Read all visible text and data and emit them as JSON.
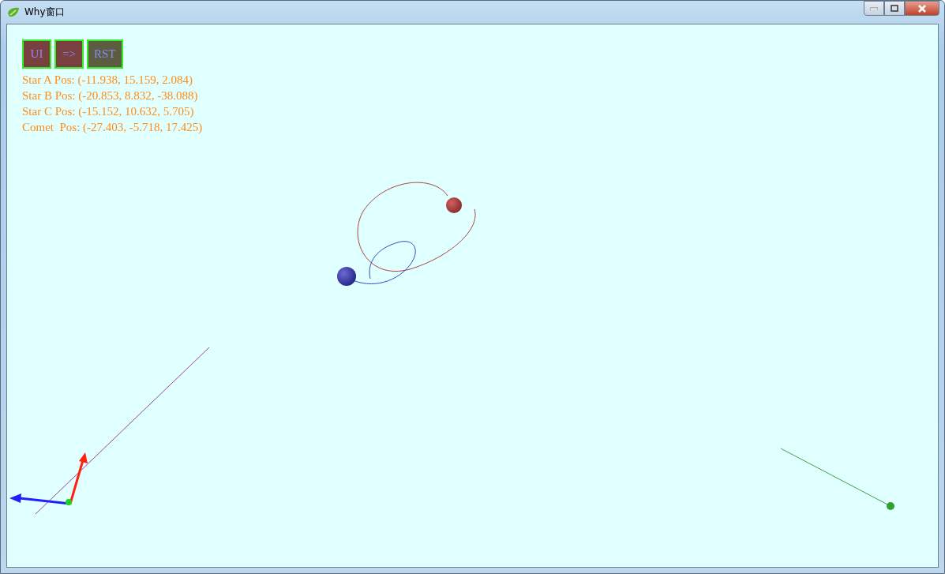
{
  "window": {
    "title": "Why窗口"
  },
  "buttons": [
    {
      "label": "UI",
      "color": "#7a4040"
    },
    {
      "label": "=>",
      "color": "#7a4040"
    },
    {
      "label": "RST",
      "color": "#5c5c40"
    }
  ],
  "positions": [
    "Star A Pos: (-11.938, 15.159, 2.084)",
    "Star B Pos: (-20.853, 8.832, -38.088)",
    "Star C Pos: (-15.152, 10.632, 5.705)",
    "Comet  Pos: (-27.403, -5.718, 17.425)"
  ]
}
